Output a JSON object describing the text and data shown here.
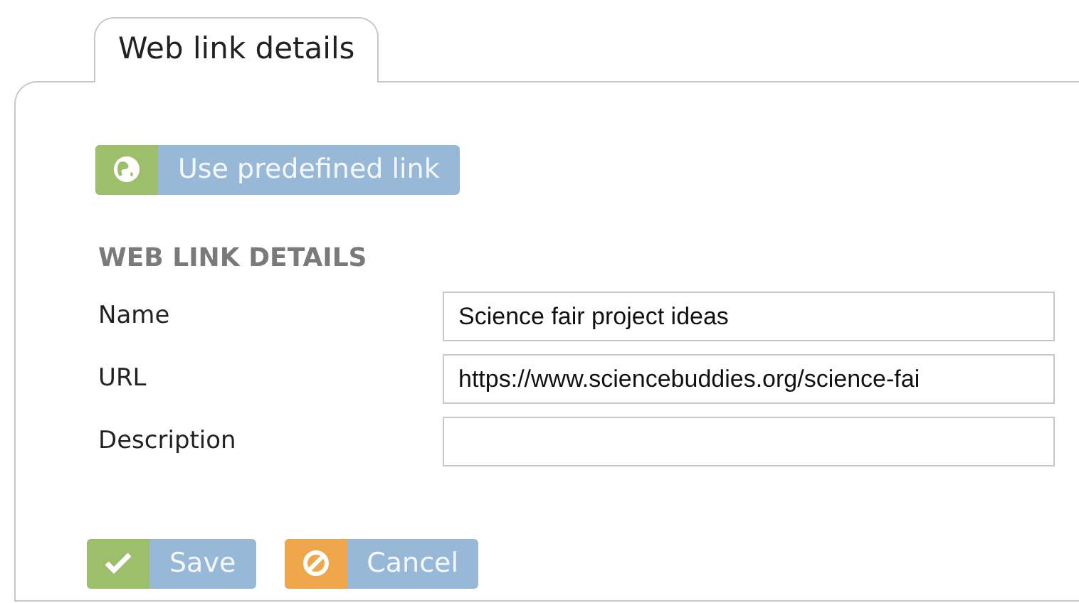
{
  "tabs": [
    {
      "label": "Web link details",
      "selected": true
    }
  ],
  "predefined_button": {
    "label": "Use predefined link"
  },
  "section_heading": "WEB LINK DETAILS",
  "fields": [
    {
      "label": "Name",
      "value": "Science fair project ideas"
    },
    {
      "label": "URL",
      "value": "https://www.sciencebuddies.org/science-fai"
    },
    {
      "label": "Description"
    }
  ],
  "buttons": [
    {
      "label": "Save",
      "kind": "save"
    },
    {
      "label": "Cancel",
      "kind": "cancel"
    }
  ]
}
